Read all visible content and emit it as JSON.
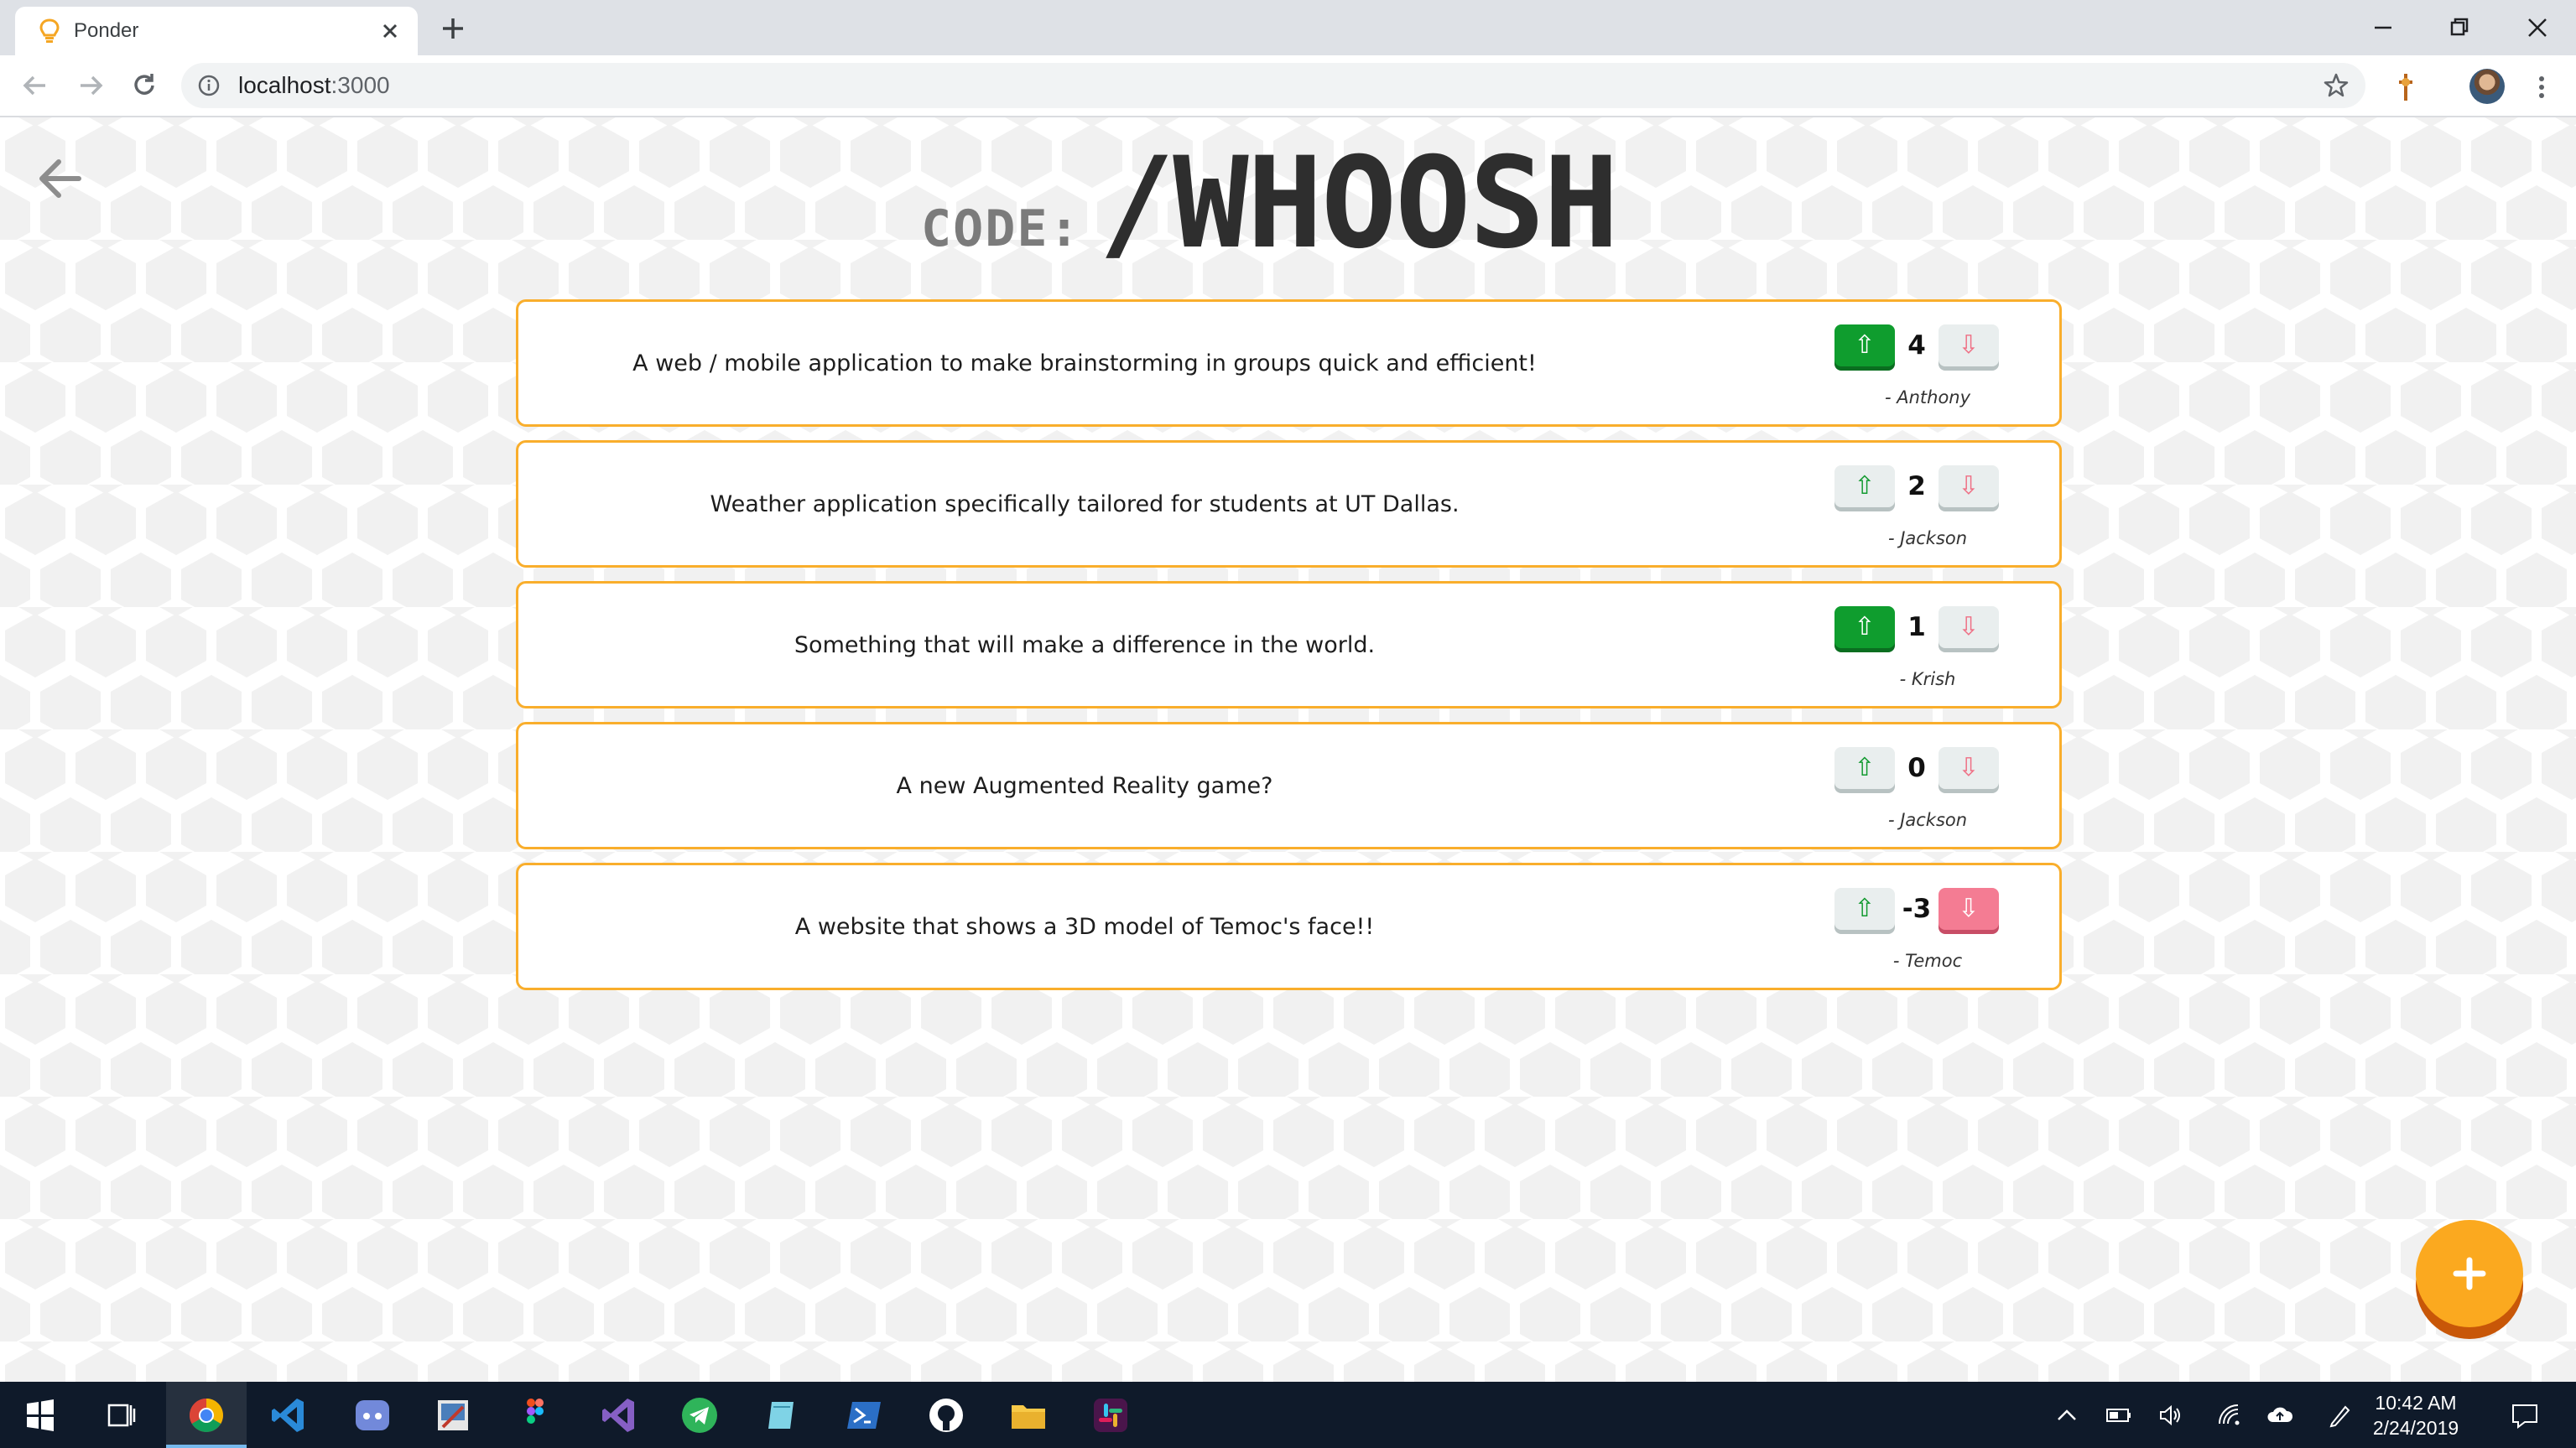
{
  "browser": {
    "tab_title": "Ponder",
    "url_host": "localhost",
    "url_port": ":3000"
  },
  "header": {
    "code_label": "CODE:",
    "code_value": "/WHOOSH"
  },
  "ideas": [
    {
      "text": "A web / mobile application to make brainstorming in groups quick and efficient!",
      "score": "4",
      "author": "- Anthony",
      "vote": "up"
    },
    {
      "text": "Weather application specifically tailored for students at UT Dallas.",
      "score": "2",
      "author": "- Jackson",
      "vote": "none"
    },
    {
      "text": "Something that will make a difference in the world.",
      "score": "1",
      "author": "- Krish",
      "vote": "up"
    },
    {
      "text": "A new Augmented Reality game?",
      "score": "0",
      "author": "- Jackson",
      "vote": "none"
    },
    {
      "text": "A website that shows a 3D model of Temoc's face!!",
      "score": "-3",
      "author": "- Temoc",
      "vote": "down"
    }
  ],
  "icons": {
    "upvote": "⇧",
    "downvote": "⇩"
  },
  "taskbar": {
    "apps": [
      "windows-start-icon",
      "task-view-icon",
      "chrome-icon",
      "vscode-icon",
      "discord-icon",
      "paint-icon",
      "figma-icon",
      "visual-studio-icon",
      "telegram-icon",
      "notepad-icon",
      "powershell-icon",
      "github-icon",
      "file-explorer-icon",
      "slack-icon"
    ],
    "time": "10:42 AM",
    "date": "2/24/2019"
  },
  "colors": {
    "accent": "#f9ae2c",
    "fab": "#fba91f",
    "upvote_active": "#0f9d2e",
    "downvote_active": "#f47c93"
  }
}
